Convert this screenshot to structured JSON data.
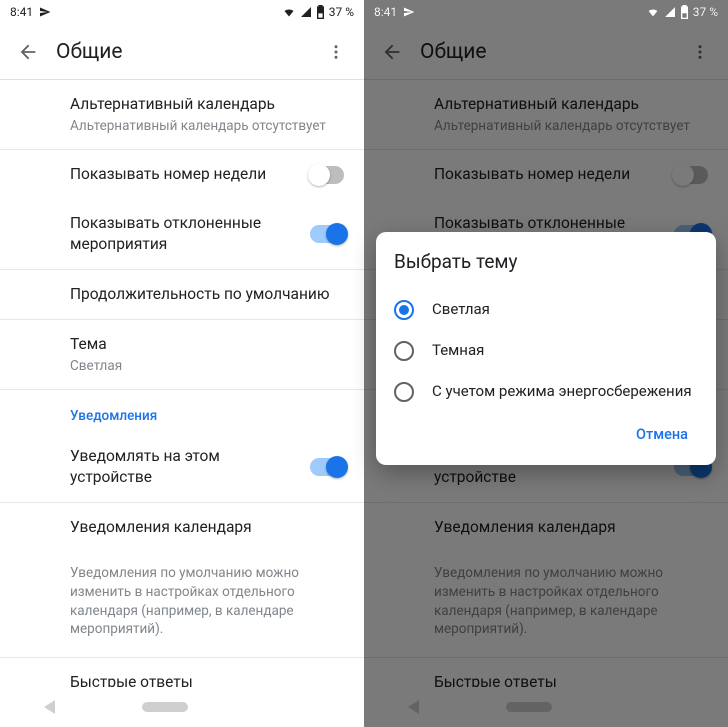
{
  "status": {
    "time": "8:41",
    "battery": "37 %",
    "battery_icon": "37"
  },
  "appbar": {
    "title": "Общие"
  },
  "settings": {
    "altcal": {
      "title": "Альтернативный календарь",
      "sub": "Альтернативный календарь отсутствует"
    },
    "weeknum": {
      "title": "Показывать номер недели",
      "on": false
    },
    "declined": {
      "title": "Показывать отклоненные мероприятия",
      "on": true
    },
    "duration": {
      "title": "Продолжительность по умолчанию"
    },
    "theme": {
      "title": "Тема",
      "sub": "Светлая"
    },
    "section_notifications": "Уведомления",
    "notify_device": {
      "title": "Уведомлять на этом устройстве",
      "on": true
    },
    "cal_notifications": {
      "title": "Уведомления календаря"
    },
    "note": "Уведомления по умолчанию можно изменить в настройках отдельного календаря (например, в календаре мероприятий).",
    "quick": {
      "title": "Быстрые ответы"
    }
  },
  "dialog": {
    "title": "Выбрать тему",
    "options": {
      "light": "Светлая",
      "dark": "Темная",
      "battery": "С учетом режима энергосбережения"
    },
    "cancel": "Отмена",
    "selected": "light"
  }
}
